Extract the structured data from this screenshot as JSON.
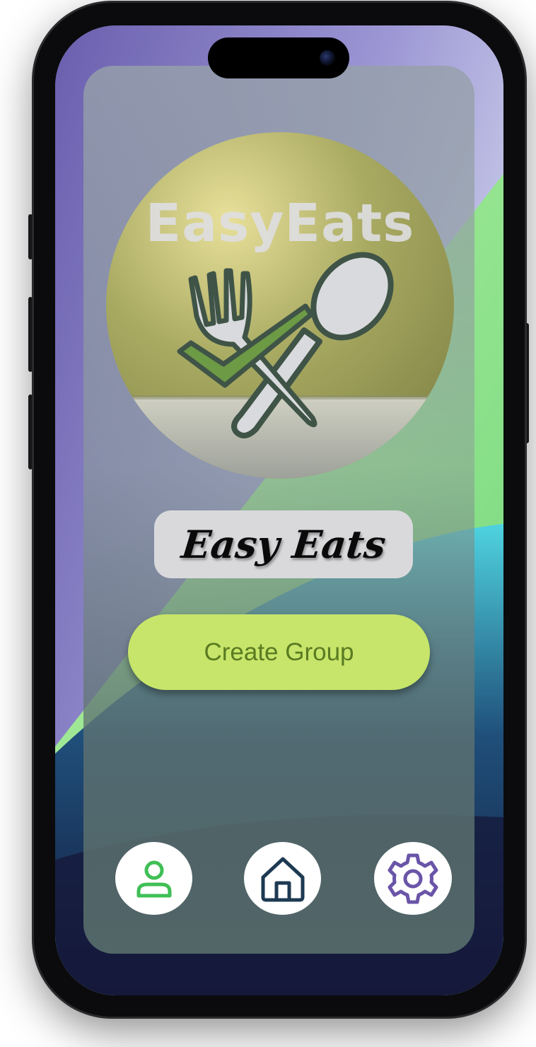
{
  "app": {
    "logo_text": "EasyEats",
    "name_banner": "Easy Eats"
  },
  "actions": {
    "create_group_label": "Create Group"
  },
  "nav": {
    "items": [
      {
        "id": "profile",
        "icon": "person-icon"
      },
      {
        "id": "home",
        "icon": "home-icon"
      },
      {
        "id": "settings",
        "icon": "gear-icon"
      }
    ]
  },
  "colors": {
    "create_button_bg": "#c6e56a",
    "create_button_text": "#5a7a22",
    "profile_icon": "#3fbf55",
    "home_icon": "#1e3a52",
    "settings_icon": "#6a55a8",
    "check_mark": "#6d9a45"
  }
}
